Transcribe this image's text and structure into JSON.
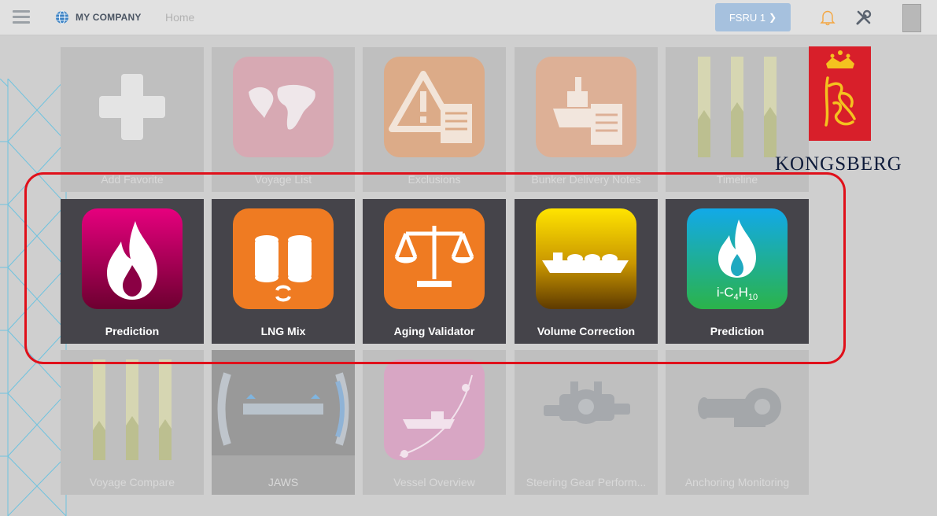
{
  "header": {
    "company": "MY COMPANY",
    "breadcrumb": "Home",
    "vessel": "FSRU 1",
    "icons": [
      "menu-icon",
      "globe-icon",
      "bell-icon",
      "tools-icon",
      "emblem-icon"
    ]
  },
  "brand": {
    "name": "KONGSBERG",
    "color": "#d81f2a"
  },
  "tiles_top": [
    {
      "label": "Add Favorite",
      "icon": "plus-icon"
    },
    {
      "label": "Voyage List",
      "icon": "world-map-icon"
    },
    {
      "label": "Exclusions",
      "icon": "warning-document-icon"
    },
    {
      "label": "Bunker Delivery Notes",
      "icon": "ship-document-icon"
    },
    {
      "label": "Timeline",
      "icon": "timeline-bars-icon"
    }
  ],
  "tiles_highlight": [
    {
      "label": "Prediction",
      "icon": "flame-icon",
      "color": "#d4006f"
    },
    {
      "label": "LNG Mix",
      "icon": "tanks-icon",
      "color": "#ef7b22"
    },
    {
      "label": "Aging Validator",
      "icon": "balance-scale-icon",
      "color": "#ef7b22"
    },
    {
      "label": "Volume Correction",
      "icon": "lng-carrier-icon",
      "color": "#e4c400"
    },
    {
      "label": "Prediction",
      "icon": "flame-formula-icon",
      "color": "#14a6df",
      "formula": "i-C4H10"
    }
  ],
  "tiles_bottom": [
    {
      "label": "Voyage Compare",
      "icon": "compare-bars-icon"
    },
    {
      "label": "JAWS",
      "icon": "gauge-icon"
    },
    {
      "label": "Vessel Overview",
      "icon": "vessel-route-icon"
    },
    {
      "label": "Steering Gear Perform...",
      "icon": "steering-gear-icon"
    },
    {
      "label": "Anchoring Monitoring",
      "icon": "anchor-winch-icon"
    }
  ]
}
